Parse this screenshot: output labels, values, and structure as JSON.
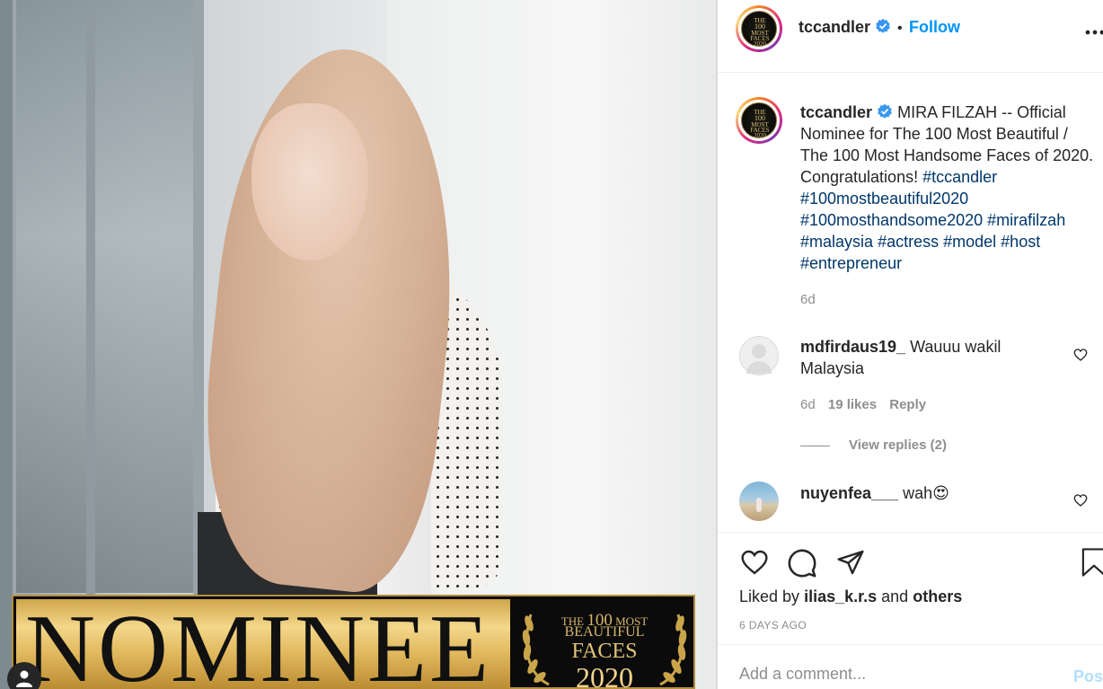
{
  "post": {
    "media": {
      "banner_word": "NOMINEE",
      "badge_line1_prefix": "THE",
      "badge_line1_num": "100",
      "badge_line1_suffix": "MOST",
      "badge_line2": "BEAUTIFUL",
      "badge_line3": "FACES",
      "badge_line4": "2020",
      "colors": {
        "gold": "#e0b75c",
        "banner_black": "#0b0b0b"
      }
    },
    "header": {
      "username": "tccandler",
      "separator": "•",
      "follow_label": "Follow",
      "more_icon": "more-horizontal-icon",
      "avatar_text": [
        "THE",
        "100",
        "MOST",
        "FACES",
        "2020"
      ]
    },
    "caption": {
      "username": "tccandler",
      "text": "MIRA FILZAH -- Official Nominee for The 100 Most Beautiful / The 100 Most Handsome Faces of 2020. Congratulations!",
      "hashtags": [
        "#tccandler",
        "#100mostbeautiful2020",
        "#100mosthandsome2020",
        "#mirafilzah",
        "#malaysia",
        "#actress",
        "#model",
        "#host",
        "#entrepreneur"
      ],
      "time": "6d"
    },
    "comments": [
      {
        "username": "mdfirdaus19_",
        "text": "Wauuu wakil Malaysia",
        "time": "6d",
        "likes": "19 likes",
        "reply_label": "Reply",
        "view_replies": "View replies (2)"
      },
      {
        "username": "nuyenfea___",
        "text": "wah",
        "emoji": "😍"
      }
    ],
    "actions": {
      "liked_by_prefix": "Liked by",
      "liked_by_user": "ilias_k.r.s",
      "liked_by_and": "and",
      "liked_by_others": "others",
      "date": "6 DAYS AGO"
    },
    "add_comment": {
      "placeholder": "Add a comment...",
      "post_label": "Post"
    },
    "colors": {
      "link_blue": "#0095f6",
      "hashtag": "#00376b",
      "muted": "#8e8e8e",
      "text": "#262626"
    }
  }
}
